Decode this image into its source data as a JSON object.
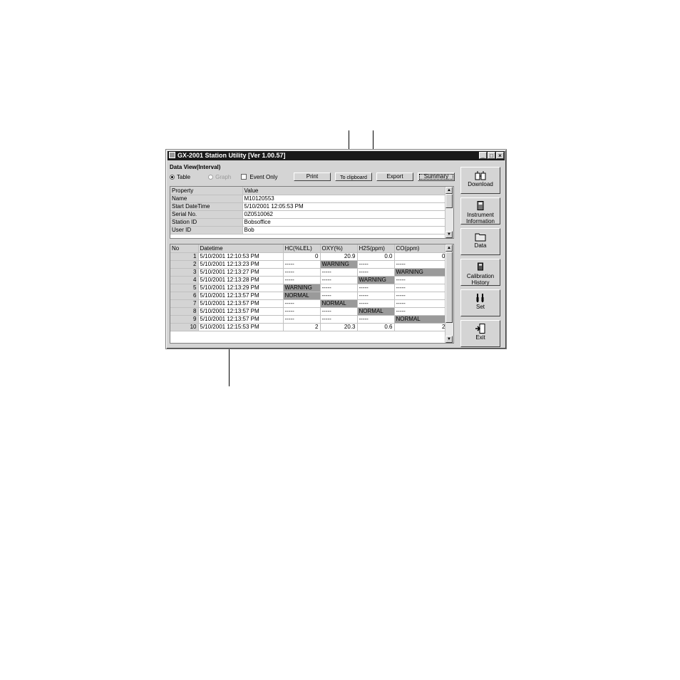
{
  "window": {
    "title": "GX-2001 Station Utility [Ver 1.00.57]",
    "controls": [
      "_",
      "□",
      "×"
    ]
  },
  "view": {
    "group_label": "Data View(Interval)",
    "table_label": "Table",
    "graph_label": "Graph",
    "event_only_label": "Event Only",
    "print_label": "Print",
    "clipboard_label": "To clipboard",
    "export_label": "Export",
    "summary_label": "Summary"
  },
  "property_grid": {
    "headers": [
      "Property",
      "Value"
    ],
    "rows": [
      [
        "Name",
        "M10120553"
      ],
      [
        "Start DateTime",
        "5/10/2001 12:05:53 PM"
      ],
      [
        "Serial No.",
        "0Z0510062"
      ],
      [
        "Station ID",
        "Bobsoffice"
      ],
      [
        "User ID",
        "Bob"
      ]
    ]
  },
  "data_grid": {
    "headers": [
      "No",
      "Datetime",
      "HC(%LEL)",
      "OXY(%)",
      "H2S(ppm)",
      "CO(ppm)"
    ],
    "rows": [
      [
        "1",
        "5/10/2001 12:10:53 PM",
        "0",
        "20.9",
        "0.0",
        "0"
      ],
      [
        "2",
        "5/10/2001 12:13:23 PM",
        "-----",
        "WARNING",
        "-----",
        "-----"
      ],
      [
        "3",
        "5/10/2001 12:13:27 PM",
        "-----",
        "-----",
        "-----",
        "WARNING"
      ],
      [
        "4",
        "5/10/2001 12:13:28 PM",
        "-----",
        "-----",
        "WARNING",
        "-----"
      ],
      [
        "5",
        "5/10/2001 12:13:29 PM",
        "WARNING",
        "-----",
        "-----",
        "-----"
      ],
      [
        "6",
        "5/10/2001 12:13:57 PM",
        "NORMAL",
        "-----",
        "-----",
        "-----"
      ],
      [
        "7",
        "5/10/2001 12:13:57 PM",
        "-----",
        "NORMAL",
        "-----",
        "-----"
      ],
      [
        "8",
        "5/10/2001 12:13:57 PM",
        "-----",
        "-----",
        "NORMAL",
        "-----"
      ],
      [
        "9",
        "5/10/2001 12:13:57 PM",
        "-----",
        "-----",
        "-----",
        "NORMAL"
      ],
      [
        "10",
        "5/10/2001 12:15:53 PM",
        "2",
        "20.3",
        "0.6",
        "2"
      ]
    ]
  },
  "sidebar": {
    "download": "Download",
    "instrument_information": "Instrument Information",
    "data": "Data",
    "calibration_history": "Calibration History",
    "set": "Set",
    "exit": "Exit"
  },
  "colors": {
    "titlebar": "#1a1a1a",
    "face": "#d4d4d4",
    "status_highlight": "#9a9a9a"
  }
}
